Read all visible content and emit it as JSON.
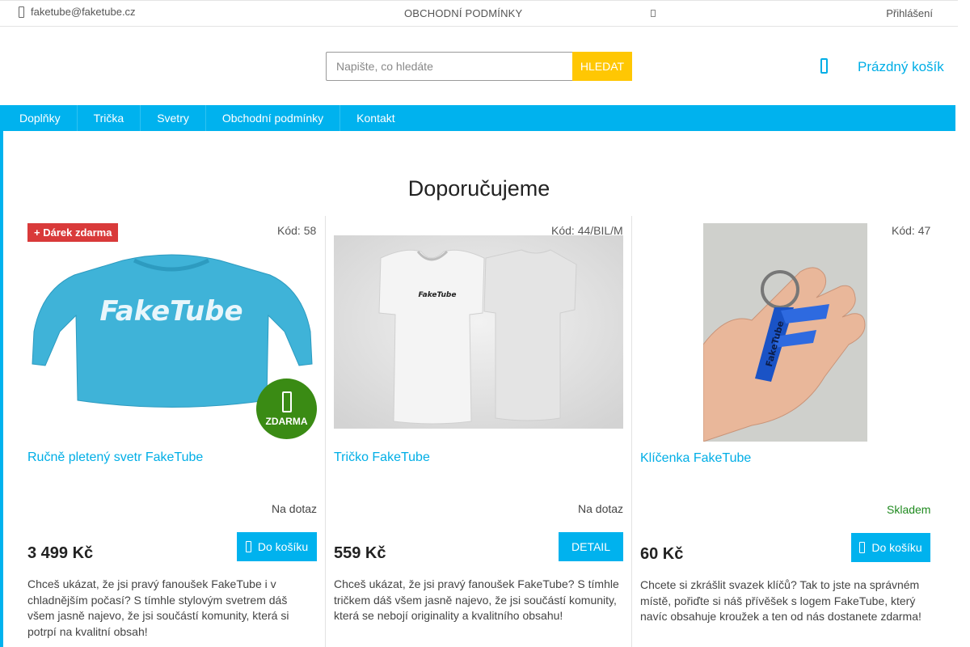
{
  "topbar": {
    "email": "faketube@faketube.cz",
    "terms": "OBCHODNÍ PODMÍNKY",
    "login": "Přihlášení"
  },
  "header": {
    "search_placeholder": "Napište, co hledáte",
    "search_button": "HLEDAT",
    "cart_label": "Prázdný košík"
  },
  "nav": {
    "items": [
      "Doplňky",
      "Trička",
      "Svetry",
      "Obchodní podmínky",
      "Kontakt"
    ]
  },
  "section": {
    "title": "Doporučujeme"
  },
  "products": [
    {
      "badge": "+ Dárek zdarma",
      "code": "Kód: 58",
      "name": "Ručně pletený svetr FakeTube",
      "availability": "Na dotaz",
      "price": "3 499 Kč",
      "button": "Do košíku",
      "free_label": "ZDARMA",
      "description": "Chceš ukázat, že jsi pravý fanoušek FakeTube i v chladnějším počasí? S tímhle stylovým svetrem dáš všem jasně najevo, že jsi součástí komunity, která si potrpí na kvalitní obsah!",
      "logo_text": "FakeTube"
    },
    {
      "code": "Kód: 44/BIL/M",
      "name": "Tričko FakeTube",
      "availability": "Na dotaz",
      "price": "559 Kč",
      "button": "DETAIL",
      "description": "Chceš ukázat, že jsi pravý fanoušek FakeTube? S tímhle tričkem dáš všem jasně najevo, že jsi součástí komunity, která se nebojí originality a kvalitního obsahu!",
      "logo_text": "FakeTube"
    },
    {
      "code": "Kód: 47",
      "name": "Klíčenka FakeTube",
      "availability": "Skladem",
      "price": "60 Kč",
      "button": "Do košíku",
      "description": "Chcete si zkrášlit svazek klíčů? Tak to jste na správném místě, pořiďte si náš přívěšek s logem FakeTube, který navíc obsahuje kroužek a ten od nás dostanete zdarma!",
      "logo_text": "FakeTube"
    }
  ],
  "colors": {
    "accent": "#00b2ee",
    "search_button": "#ffc703",
    "in_stock": "#1f8a1f",
    "gift_badge": "#d93a3a",
    "free_badge": "#3a8b14"
  },
  "icons": {
    "phone": "phone-icon",
    "cart": "cart-icon",
    "gift": "gift-icon",
    "basket_button": "cart-button-icon"
  }
}
